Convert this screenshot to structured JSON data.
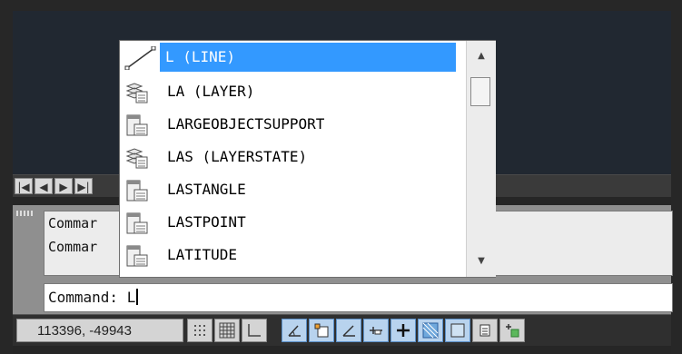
{
  "autocomplete": {
    "items": [
      {
        "label": "L (LINE)",
        "icon": "line-icon",
        "selected": true
      },
      {
        "label": "LA (LAYER)",
        "icon": "layer-icon",
        "selected": false
      },
      {
        "label": "LARGEOBJECTSUPPORT",
        "icon": "command-window-icon",
        "selected": false
      },
      {
        "label": "LAS (LAYERSTATE)",
        "icon": "layer-icon",
        "selected": false
      },
      {
        "label": "LASTANGLE",
        "icon": "command-window-icon",
        "selected": false
      },
      {
        "label": "LASTPOINT",
        "icon": "command-window-icon",
        "selected": false
      },
      {
        "label": "LATITUDE",
        "icon": "command-window-icon",
        "selected": false
      }
    ],
    "selection_color": "#3399ff"
  },
  "command_history": {
    "lines": [
      "Commar",
      "Commar"
    ]
  },
  "command_line": {
    "prompt": "Command:",
    "value": "L"
  },
  "status_bar": {
    "coordinates": "113396, -49943",
    "buttons": [
      {
        "name": "snap-icon",
        "on": false
      },
      {
        "name": "grid-icon",
        "on": false
      },
      {
        "name": "ortho-icon",
        "on": false
      },
      {
        "name": "polar-icon",
        "on": true
      },
      {
        "name": "osnap-icon",
        "on": true
      },
      {
        "name": "otrack-icon",
        "on": true
      },
      {
        "name": "ducs-icon",
        "on": true
      },
      {
        "name": "dyn-icon",
        "on": true
      },
      {
        "name": "lineweight-icon",
        "on": true
      },
      {
        "name": "transparency-icon",
        "on": true
      },
      {
        "name": "quick-properties-icon",
        "on": false
      },
      {
        "name": "selection-cycling-icon",
        "on": false
      }
    ]
  },
  "tab_navigation": {
    "buttons": [
      "first-icon",
      "prev-icon",
      "next-icon",
      "last-icon"
    ]
  }
}
